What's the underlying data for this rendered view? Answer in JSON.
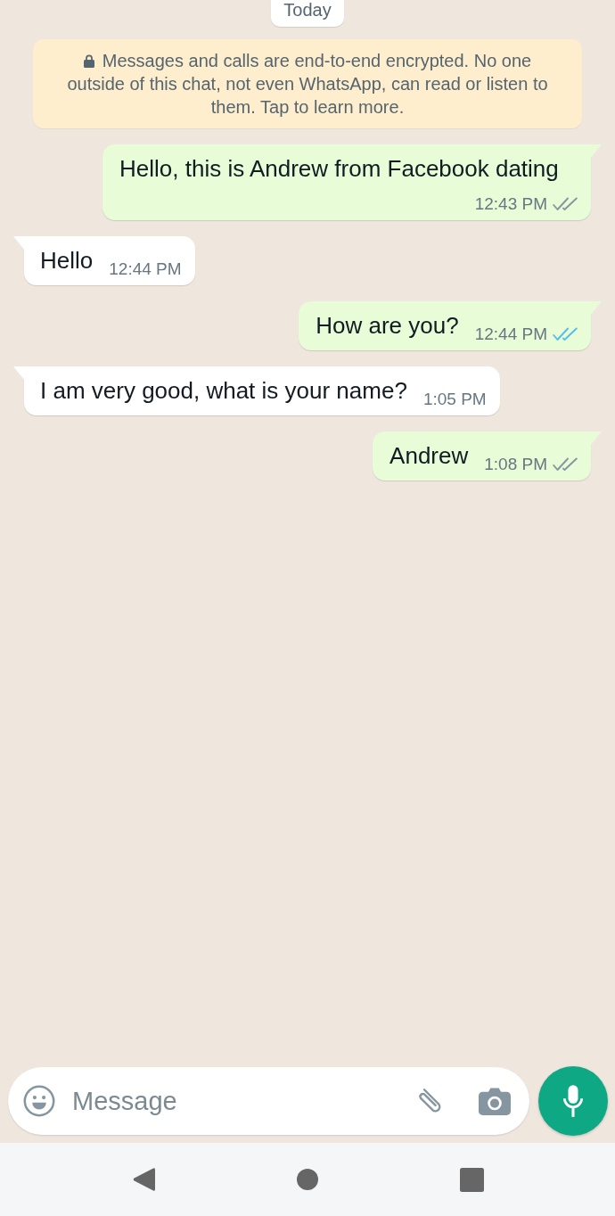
{
  "date_chip": {
    "label": "Today"
  },
  "encryption_notice": {
    "text": "Messages and calls are end-to-end encrypted. No one outside of this chat, not even WhatsApp, can read or listen to them. Tap to learn more."
  },
  "messages": [
    {
      "kind": "outgoing",
      "text": "Hello, this is Andrew from Facebook dating",
      "time": "12:43 PM",
      "read": false
    },
    {
      "kind": "incoming",
      "text": "Hello",
      "time": "12:44 PM"
    },
    {
      "kind": "outgoing",
      "text": "How are you?",
      "time": "12:44 PM",
      "read": true
    },
    {
      "kind": "incoming",
      "text": "I am very good, what is your name?",
      "time": "1:05 PM"
    },
    {
      "kind": "outgoing",
      "text": "Andrew",
      "time": "1:08 PM",
      "read": false
    }
  ],
  "composer": {
    "placeholder": "Message"
  }
}
